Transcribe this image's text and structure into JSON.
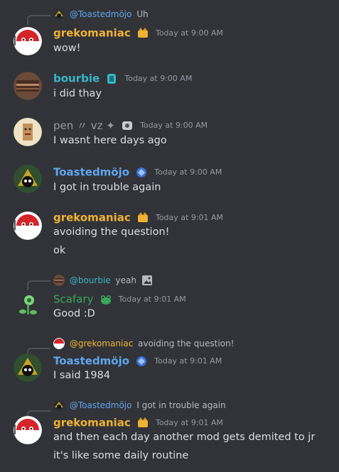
{
  "colors": {
    "background": "#313338",
    "text": "#dbdee1",
    "muted": "#949ba4",
    "gold": "#f0b232",
    "blue": "#5fa6ee",
    "teal": "#37b6c8",
    "green": "#3ba55c",
    "gray": "#949ba4"
  },
  "messages": [
    {
      "reply": {
        "name": "@Toastedmöjo",
        "text": "Uh"
      },
      "author": "grekomaniac",
      "time": "Today at 9:00 AM",
      "lines": [
        "wow!"
      ]
    },
    {
      "author": "bourbie",
      "time": "Today at 9:00 AM",
      "lines": [
        "i did thay"
      ]
    },
    {
      "author": "pen 〃 vz ✦",
      "time": "Today at 9:00 AM",
      "lines": [
        "I wasnt here days ago"
      ]
    },
    {
      "author": "Toastedmöjo",
      "time": "Today at 9:00 AM",
      "lines": [
        "I got in trouble again"
      ]
    },
    {
      "author": "grekomaniac",
      "time": "Today at 9:01 AM",
      "lines": [
        "avoiding the question!",
        "ok"
      ]
    },
    {
      "reply": {
        "name": "@bourbie",
        "text": "yeah"
      },
      "author": "Scafary",
      "time": "Today at 9:01 AM",
      "lines": [
        "Good :D"
      ]
    },
    {
      "reply": {
        "name": "@grekomaniac",
        "text": "avoiding the question!"
      },
      "author": "Toastedmöjo",
      "time": "Today at 9:01 AM",
      "lines": [
        "I said 1984"
      ]
    },
    {
      "reply": {
        "name": "@Toastedmöjo",
        "text": "I got in trouble again"
      },
      "author": "grekomaniac",
      "time": "Today at 9:01 AM",
      "lines": [
        "and then each day another mod gets demited to jr",
        "it's like some daily routine"
      ]
    }
  ]
}
